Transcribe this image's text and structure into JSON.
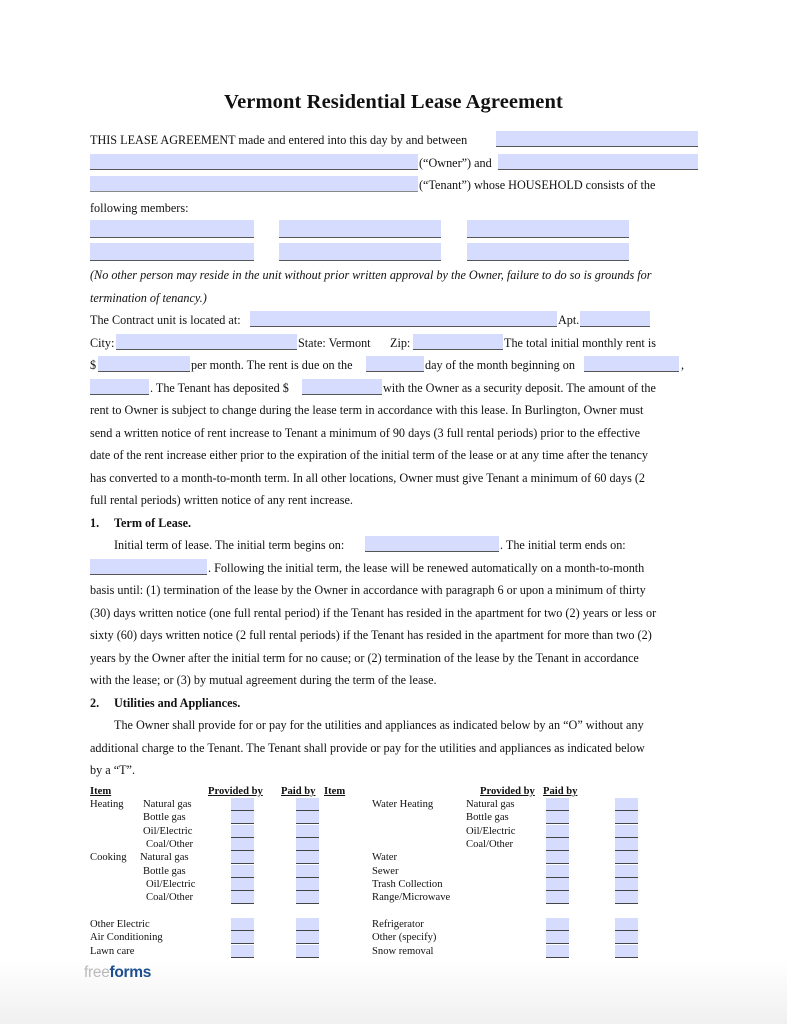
{
  "document": {
    "title": "Vermont Residential Lease Agreement",
    "intro": {
      "line1": "THIS LEASE AGREEMENT made and entered into this day by and between",
      "owner_label": "(“Owner”) and",
      "tenant_label": "(“Tenant”) whose HOUSEHOLD consists of the",
      "members_label": "following members:",
      "note_line1": "(No other person may reside in the unit without prior written approval by the Owner, failure to do so is grounds for",
      "note_line2": "termination of tenancy.)"
    },
    "fields": {
      "owner_name": "",
      "owner_name_cont": "",
      "tenant_name": "",
      "tenant_name_cont": "",
      "household_members": [
        "",
        "",
        "",
        "",
        "",
        ""
      ],
      "unit_address": "",
      "apt": "",
      "city": "",
      "zip": "",
      "monthly_rent": "",
      "due_day": "",
      "begin_date": "",
      "begin_year": "",
      "security_deposit": "",
      "term_begins": "",
      "term_ends": ""
    },
    "location": {
      "located_label": "The Contract unit is located at:",
      "apt_label": "Apt.",
      "city_label": "City:",
      "state_label": "State: Vermont",
      "zip_label": "Zip:",
      "rent_label": "The total initial monthly rent is",
      "dollar": "$",
      "per_month": "per month.  The rent is due on the",
      "day_of_month": "day of the month beginning on",
      "comma": ",",
      "deposited": ".  The Tenant has deposited $",
      "deposit_rest": "with the Owner as a security deposit. The amount of the"
    },
    "rent_paragraph": [
      "rent to Owner is subject to change during the lease term in accordance with this lease. In Burlington, Owner must",
      "send a written notice of rent increase to Tenant a minimum of 90 days (3 full rental periods) prior to the effective",
      "date of the rent increase either prior to the expiration of the initial term of the lease or at any time after the tenancy",
      "has converted to a month-to-month term. In all other locations, Owner must give Tenant a minimum of 60 days (2",
      "full rental periods) written notice of any rent increase."
    ],
    "section1": {
      "number": "1.",
      "heading": "Term of Lease.",
      "begins_label": "Initial term of lease.   The initial term begins on:",
      "ends_label": ". The initial term ends on:",
      "following": ". Following the initial term, the lease will be renewed automatically on a month-to-month",
      "lines": [
        "basis until: (1) termination of the lease by the Owner in accordance with paragraph 6 or upon a minimum of thirty",
        "(30) days written notice (one full rental period) if the Tenant has resided in the apartment for two (2) years or less or",
        "sixty (60) days written notice (2 full rental periods) if the Tenant has resided in the apartment for more than two (2)",
        "years by the Owner after the initial term for no cause; or (2) termination of the lease by the Tenant in accordance",
        "with the lease; or (3) by mutual agreement during the term of the lease."
      ]
    },
    "section2": {
      "number": "2.",
      "heading": "Utilities and Appliances.",
      "lines": [
        "The Owner shall provide for or pay for the utilities and appliances as indicated below by an “O” without any",
        "additional charge to the Tenant. The Tenant shall provide or pay for the utilities and appliances as indicated below",
        "by a “T”."
      ]
    },
    "utilities_table": {
      "headers": {
        "item": "Item",
        "provided_by": "Provided by",
        "paid_by": "Paid by"
      },
      "left": [
        {
          "category": "Heating",
          "option": "Natural gas",
          "provided_by": "",
          "paid_by": ""
        },
        {
          "category": "",
          "option": "Bottle gas",
          "provided_by": "",
          "paid_by": ""
        },
        {
          "category": "",
          "option": "Oil/Electric",
          "provided_by": "",
          "paid_by": ""
        },
        {
          "category": "",
          "option": "Coal/Other",
          "provided_by": "",
          "paid_by": ""
        },
        {
          "category": "Cooking",
          "option": "Natural gas",
          "provided_by": "",
          "paid_by": ""
        },
        {
          "category": "",
          "option": "Bottle gas",
          "provided_by": "",
          "paid_by": ""
        },
        {
          "category": "",
          "option": "Oil/Electric",
          "provided_by": "",
          "paid_by": ""
        },
        {
          "category": "",
          "option": "Coal/Other",
          "provided_by": "",
          "paid_by": ""
        }
      ],
      "right": [
        {
          "category": "Water Heating",
          "option": "Natural gas",
          "provided_by": "",
          "paid_by": ""
        },
        {
          "category": "",
          "option": "Bottle gas",
          "provided_by": "",
          "paid_by": ""
        },
        {
          "category": "",
          "option": "Oil/Electric",
          "provided_by": "",
          "paid_by": ""
        },
        {
          "category": "",
          "option": "Coal/Other",
          "provided_by": "",
          "paid_by": ""
        },
        {
          "category": "Water",
          "option": "",
          "provided_by": "",
          "paid_by": ""
        },
        {
          "category": "Sewer",
          "option": "",
          "provided_by": "",
          "paid_by": ""
        },
        {
          "category": "Trash Collection",
          "option": "",
          "provided_by": "",
          "paid_by": ""
        },
        {
          "category": "Range/Microwave",
          "option": "",
          "provided_by": "",
          "paid_by": ""
        }
      ],
      "left_extra": [
        {
          "category": "Other Electric",
          "provided_by": "",
          "paid_by": ""
        },
        {
          "category": "Air Conditioning",
          "provided_by": "",
          "paid_by": ""
        },
        {
          "category": "Lawn care",
          "provided_by": "",
          "paid_by": ""
        }
      ],
      "right_extra": [
        {
          "category": "Refrigerator",
          "provided_by": "",
          "paid_by": ""
        },
        {
          "category": "Other (specify)",
          "provided_by": "",
          "paid_by": ""
        },
        {
          "category": "Snow removal",
          "provided_by": "",
          "paid_by": ""
        }
      ]
    },
    "footer": {
      "logo_free": "free",
      "logo_forms": "forms"
    }
  },
  "colors": {
    "field_fill": "#d6dcfe",
    "logo_blue": "#1d4f8f",
    "logo_gray": "#b9b9b9"
  }
}
